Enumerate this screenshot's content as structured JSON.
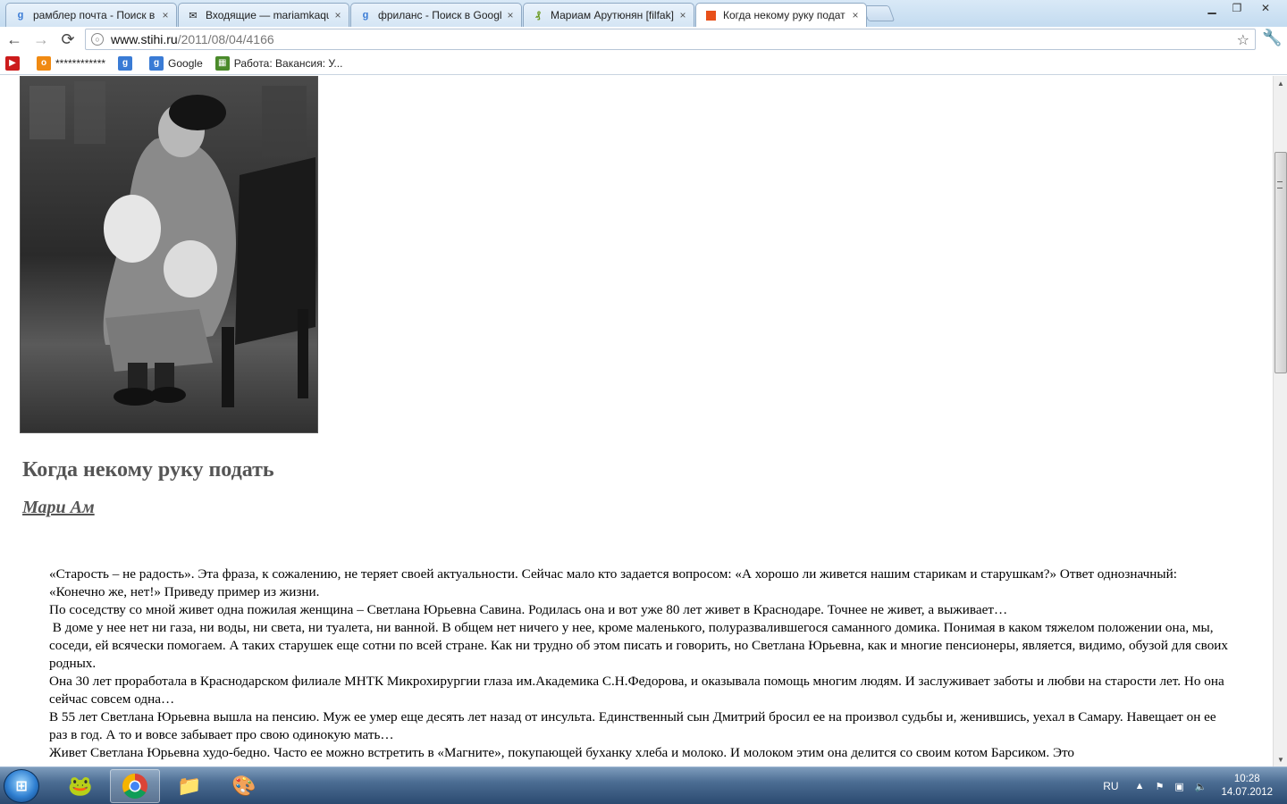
{
  "browser": {
    "tabs": [
      {
        "title": "рамблер почта - Поиск в",
        "favicon": "google-icon",
        "active": false
      },
      {
        "title": "Входящие — mariamkaqu",
        "favicon": "mail-icon",
        "active": false
      },
      {
        "title": "фриланс - Поиск в Googl",
        "favicon": "google-icon",
        "active": false
      },
      {
        "title": "Мариам Арутюнян [filfak]",
        "favicon": "fl-icon",
        "active": false
      },
      {
        "title": "Когда некому руку подат",
        "favicon": "stihi-icon",
        "active": true
      }
    ],
    "tab_close": "×",
    "window_controls": {
      "minimize": "▁",
      "maximize": "❐",
      "close": "✕"
    },
    "address": {
      "host": "www.stihi.ru",
      "path": "/2011/08/04/4166"
    },
    "nav": {
      "back": "←",
      "forward": "→",
      "reload": "⟳",
      "star": "☆",
      "wrench": "🔧"
    },
    "bookmarks": [
      {
        "label": "",
        "icon": "youtube-icon",
        "color": "#cc1b1b"
      },
      {
        "label": "************",
        "icon": "odnoklassniki-icon",
        "color": "#f08a12"
      },
      {
        "label": "",
        "icon": "google-icon",
        "color": "#3a7bd5"
      },
      {
        "label": "Google",
        "icon": "google-icon",
        "color": "#3a7bd5"
      },
      {
        "label": "Работа: Вакансия: У...",
        "icon": "rabota-icon",
        "color": "#4a8a2a"
      }
    ]
  },
  "page": {
    "title": "Когда некому руку подать",
    "author": "Мари Ам",
    "paragraphs": [
      "«Старость – не радость». Эта фраза, к сожалению, не теряет своей актуальности. Сейчас мало кто задается вопросом: «А хорошо ли живется нашим старикам и старушкам?» Ответ однозначный: «Конечно же, нет!» Приведу пример из жизни.",
      "По соседству со мной живет одна пожилая женщина – Светлана Юрьевна Савина. Родилась она и вот уже 80 лет живет в Краснодаре. Точнее не живет, а выживает…",
      " В доме у нее нет ни газа, ни воды, ни света, ни туалета, ни ванной. В общем нет ничего у нее, кроме маленького, полуразвалившегося саманного домика. Понимая в каком тяжелом положении она, мы, соседи, ей всячески помогаем. А таких старушек еще сотни по всей стране. Как ни трудно об этом писать и говорить, но Светлана Юрьевна, как и многие пенсионеры, является, видимо, обузой для своих родных.",
      "Она 30 лет проработала в Краснодарском филиале МНТК Микрохирургии глаза им.Академика С.Н.Федорова, и оказывала помощь многим людям. И заслуживает заботы и любви на старости лет. Но она сейчас совсем одна…",
      "В 55 лет Светлана Юрьевна вышла на пенсию. Муж ее умер еще десять лет назад от инсульта. Единственный сын Дмитрий бросил ее на произвол судьбы и, женившись, уехал в Самару. Навещает он ее раз в год. А то и вовсе забывает про свою одинокую мать…",
      "Живет Светлана Юрьевна худо-бедно. Часто ее можно встретить в «Магните», покупающей буханку хлеба и молоко. И молоком этим она делится со своим котом Барсиком. Это"
    ]
  },
  "taskbar": {
    "start": "⊞",
    "apps": [
      {
        "name": "frog-app-icon",
        "glyph": "🐸",
        "active": false
      },
      {
        "name": "chrome-icon",
        "glyph": "◉",
        "active": true
      },
      {
        "name": "explorer-icon",
        "glyph": "📁",
        "active": false
      },
      {
        "name": "paint-icon",
        "glyph": "🎨",
        "active": false
      }
    ],
    "lang": "RU",
    "tray_icons": [
      "▲",
      "⚑",
      "▣",
      "🔈"
    ],
    "time": "10:28",
    "date": "14.07.2012"
  }
}
